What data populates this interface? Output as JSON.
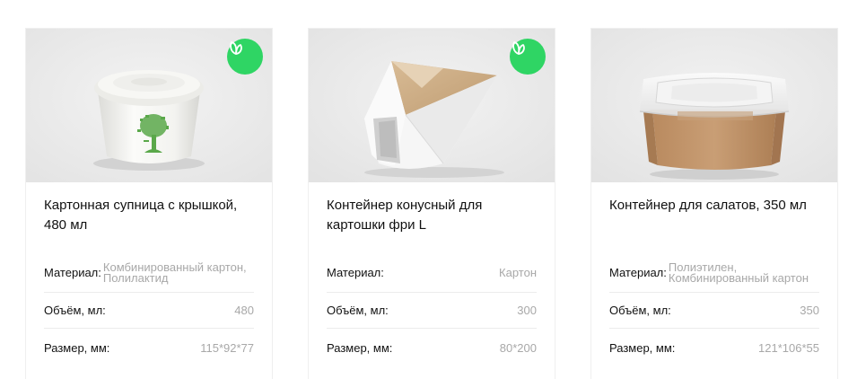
{
  "cards": [
    {
      "title": "Картонная супница с крышкой, 480 мл",
      "eco_badge": true,
      "image_icon": "paper-soup-cup-with-lid",
      "specs": [
        {
          "label": "Материал:",
          "value": "Комбинированный картон, Полилактид"
        },
        {
          "label": "Объём, мл:",
          "value": "480"
        },
        {
          "label": "Размер, мм:",
          "value": "115*92*77"
        }
      ]
    },
    {
      "title": "Контейнер конусный для картошки фри L",
      "eco_badge": true,
      "image_icon": "kraft-fries-cone",
      "specs": [
        {
          "label": "Материал:",
          "value": "Картон"
        },
        {
          "label": "Объём, мл:",
          "value": "300"
        },
        {
          "label": "Размер, мм:",
          "value": "80*200"
        }
      ]
    },
    {
      "title": "Контейнер для салатов, 350 мл",
      "eco_badge": false,
      "image_icon": "kraft-salad-box-with-clear-lid",
      "specs": [
        {
          "label": "Материал:",
          "value": "Полиэтилен, Комбинированный картон"
        },
        {
          "label": "Объём, мл:",
          "value": "350"
        },
        {
          "label": "Размер, мм:",
          "value": "121*106*55"
        }
      ]
    }
  ],
  "colors": {
    "eco_badge": "#2fd564",
    "image_bg": "#ebebeb",
    "value_text": "#a8a8a8",
    "divider": "#ececec"
  }
}
